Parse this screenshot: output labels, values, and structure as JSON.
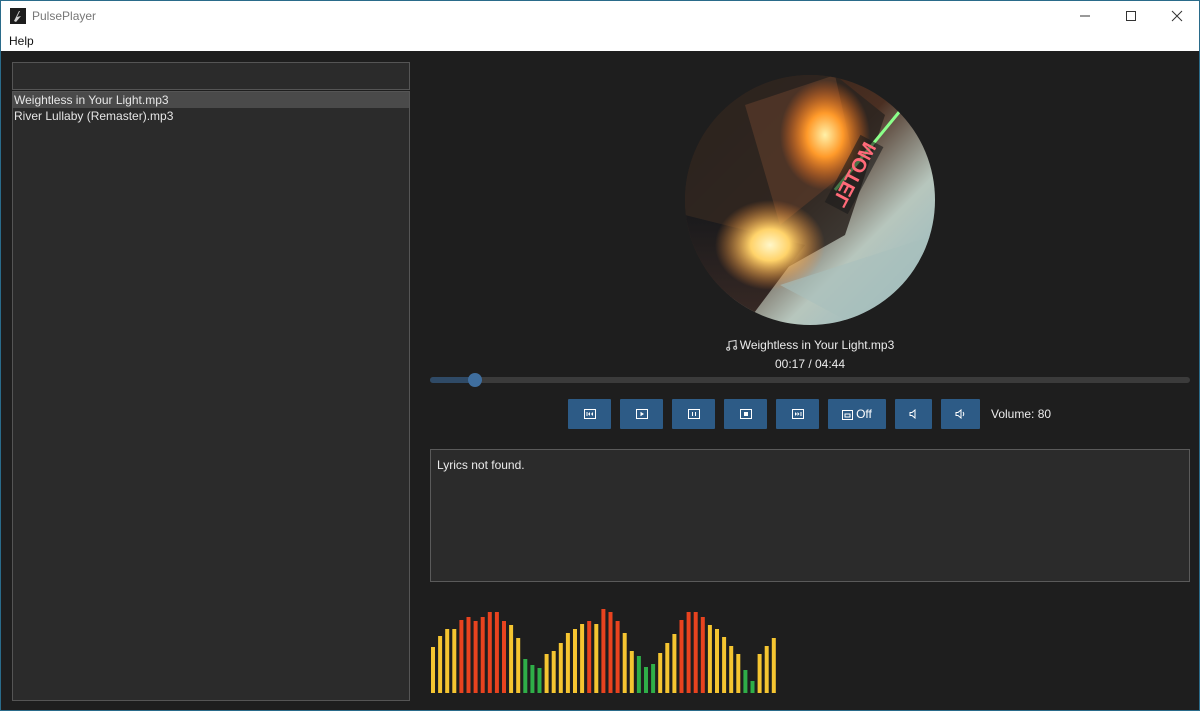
{
  "window": {
    "title": "PulsePlayer"
  },
  "menu": {
    "items": [
      "Help"
    ]
  },
  "playlist": {
    "search_value": "",
    "items": [
      {
        "label": "Weightless in Your Light.mp3",
        "selected": true
      },
      {
        "label": "River Lullaby (Remaster).mp3",
        "selected": false
      }
    ]
  },
  "player": {
    "track_title": "Weightless in Your Light.mp3",
    "time_display": "00:17 / 04:44",
    "elapsed_seconds": 17,
    "duration_seconds": 284,
    "repeat_label": "Off",
    "volume_label": "Volume: 80",
    "volume": 80,
    "cover_icon": "motel-neon-sign-photo",
    "controls": [
      {
        "name": "previous-button",
        "icon": "skip-previous-icon"
      },
      {
        "name": "play-button",
        "icon": "play-icon"
      },
      {
        "name": "pause-button",
        "icon": "pause-icon"
      },
      {
        "name": "stop-button",
        "icon": "stop-icon"
      },
      {
        "name": "next-button",
        "icon": "skip-next-icon"
      },
      {
        "name": "repeat-button",
        "icon": "repeat-icon"
      },
      {
        "name": "volume-down-button",
        "icon": "volume-down-icon"
      },
      {
        "name": "volume-up-button",
        "icon": "volume-up-icon"
      }
    ]
  },
  "lyrics": {
    "text": "Lyrics not found."
  },
  "visualizer": {
    "levels": [
      0.55,
      0.68,
      0.76,
      0.76,
      0.87,
      0.91,
      0.86,
      0.91,
      0.96,
      0.96,
      0.86,
      0.81,
      0.66,
      0.4,
      0.33,
      0.3,
      0.47,
      0.5,
      0.6,
      0.71,
      0.76,
      0.82,
      0.86,
      0.82,
      1.0,
      0.96,
      0.86,
      0.71,
      0.5,
      0.44,
      0.31,
      0.34,
      0.48,
      0.6,
      0.7,
      0.87,
      0.96,
      0.96,
      0.91,
      0.81,
      0.76,
      0.67,
      0.56,
      0.46,
      0.27,
      0.14,
      0.46,
      0.56,
      0.66
    ],
    "colors": {
      "low": "#2fae48",
      "mid": "#f5c531",
      "high": "#e8431f"
    }
  },
  "theme": {
    "accent": "#2d5b86",
    "background": "#1e1e1e",
    "panel": "#2b2b2b"
  }
}
